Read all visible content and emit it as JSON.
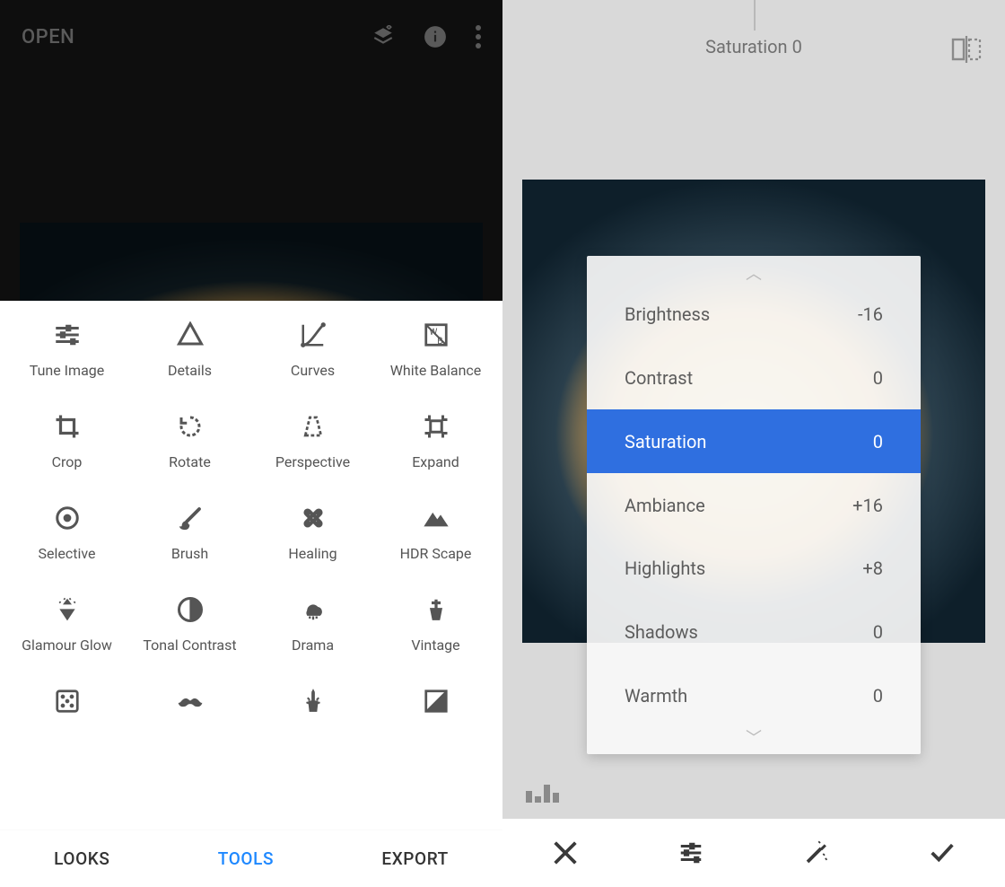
{
  "left": {
    "open_label": "OPEN",
    "tabs": {
      "looks": "LOOKS",
      "tools": "TOOLS",
      "export": "EXPORT"
    },
    "active_tab": "tools",
    "tools": [
      {
        "id": "tune",
        "label": "Tune Image"
      },
      {
        "id": "details",
        "label": "Details"
      },
      {
        "id": "curves",
        "label": "Curves"
      },
      {
        "id": "wb",
        "label": "White Balance"
      },
      {
        "id": "crop",
        "label": "Crop"
      },
      {
        "id": "rotate",
        "label": "Rotate"
      },
      {
        "id": "perspective",
        "label": "Perspective"
      },
      {
        "id": "expand",
        "label": "Expand"
      },
      {
        "id": "selective",
        "label": "Selective"
      },
      {
        "id": "brush",
        "label": "Brush"
      },
      {
        "id": "healing",
        "label": "Healing"
      },
      {
        "id": "hdr",
        "label": "HDR Scape"
      },
      {
        "id": "glamour",
        "label": "Glamour Glow"
      },
      {
        "id": "tonal",
        "label": "Tonal Contrast"
      },
      {
        "id": "drama",
        "label": "Drama"
      },
      {
        "id": "vintage",
        "label": "Vintage"
      },
      {
        "id": "grainy",
        "label": ""
      },
      {
        "id": "retrolux",
        "label": ""
      },
      {
        "id": "grunge",
        "label": ""
      },
      {
        "id": "bw",
        "label": ""
      }
    ]
  },
  "right": {
    "header_param": "Saturation",
    "header_value": "0",
    "params": [
      {
        "name": "Brightness",
        "value": "-16",
        "selected": false
      },
      {
        "name": "Contrast",
        "value": "0",
        "selected": false
      },
      {
        "name": "Saturation",
        "value": "0",
        "selected": true
      },
      {
        "name": "Ambiance",
        "value": "+16",
        "selected": false
      },
      {
        "name": "Highlights",
        "value": "+8",
        "selected": false
      },
      {
        "name": "Shadows",
        "value": "0",
        "selected": false
      },
      {
        "name": "Warmth",
        "value": "0",
        "selected": false
      }
    ]
  }
}
